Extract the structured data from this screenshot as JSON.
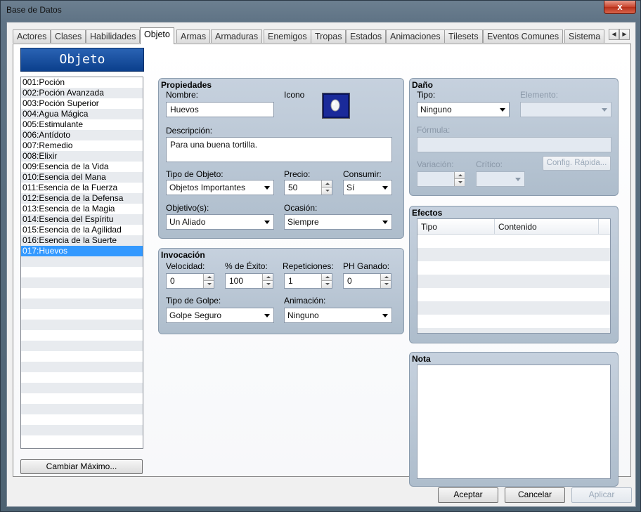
{
  "window": {
    "title": "Base de Datos",
    "close_glyph": "x"
  },
  "tabs": [
    {
      "label": "Actores"
    },
    {
      "label": "Clases"
    },
    {
      "label": "Habilidades"
    },
    {
      "label": "Objeto"
    },
    {
      "label": "Armas"
    },
    {
      "label": "Armaduras"
    },
    {
      "label": "Enemigos"
    },
    {
      "label": "Tropas"
    },
    {
      "label": "Estados"
    },
    {
      "label": "Animaciones"
    },
    {
      "label": "Tilesets"
    },
    {
      "label": "Eventos Comunes"
    },
    {
      "label": "Sistema"
    }
  ],
  "active_tab": "Objeto",
  "tab_scroll": {
    "left": "◀",
    "right": "▶"
  },
  "list": {
    "header": "Objeto",
    "items": [
      "001:Poción",
      "002:Poción Avanzada",
      "003:Poción Superior",
      "004:Agua Mágica",
      "005:Estimulante",
      "006:Antídoto",
      "007:Remedio",
      "008:Elixir",
      "009:Esencia de la Vida",
      "010:Esencia del Mana",
      "011:Esencia de la Fuerza",
      "012:Esencia de la Defensa",
      "013:Esencia de la Magia",
      "014:Esencia del Espíritu",
      "015:Esencia de la Agilidad",
      "016:Esencia de la Suerte",
      "017:Huevos"
    ],
    "selected_item": "017:Huevos",
    "change_max_button": "Cambiar Máximo..."
  },
  "properties": {
    "title": "Propiedades",
    "name_label": "Nombre:",
    "name_value": "Huevos",
    "icon_label": "Icono",
    "icon": "egg-icon",
    "description_label": "Descripción:",
    "description_value": "Para una buena tortilla.",
    "item_type_label": "Tipo de Objeto:",
    "item_type_value": "Objetos Importantes",
    "price_label": "Precio:",
    "price_value": "50",
    "consume_label": "Consumir:",
    "consume_value": "Sí",
    "scope_label": "Objetivo(s):",
    "scope_value": "Un Aliado",
    "occasion_label": "Ocasión:",
    "occasion_value": "Siempre"
  },
  "invocation": {
    "title": "Invocación",
    "speed_label": "Velocidad:",
    "speed_value": "0",
    "success_label": "% de Éxito:",
    "success_value": "100",
    "repeat_label": "Repeticiones:",
    "repeat_value": "1",
    "tp_label": "PH Ganado:",
    "tp_value": "0",
    "hit_type_label": "Tipo de Golpe:",
    "hit_type_value": "Golpe Seguro",
    "animation_label": "Animación:",
    "animation_value": "Ninguno"
  },
  "damage": {
    "title": "Daño",
    "type_label": "Tipo:",
    "type_value": "Ninguno",
    "element_label": "Elemento:",
    "element_value": "",
    "formula_label": "Fórmula:",
    "formula_value": "",
    "variance_label": "Variación:",
    "variance_value": "",
    "critical_label": "Crítico:",
    "critical_value": "",
    "quick_config_button": "Config. Rápida..."
  },
  "effects": {
    "title": "Efectos",
    "columns": [
      "Tipo",
      "Contenido"
    ]
  },
  "note": {
    "title": "Nota",
    "value": ""
  },
  "buttons": {
    "ok": "Aceptar",
    "cancel": "Cancelar",
    "apply": "Aplicar"
  },
  "colors": {
    "selection": "#3399ff",
    "header_blue": "#1d52a3",
    "panel": "#b8c5d4"
  }
}
